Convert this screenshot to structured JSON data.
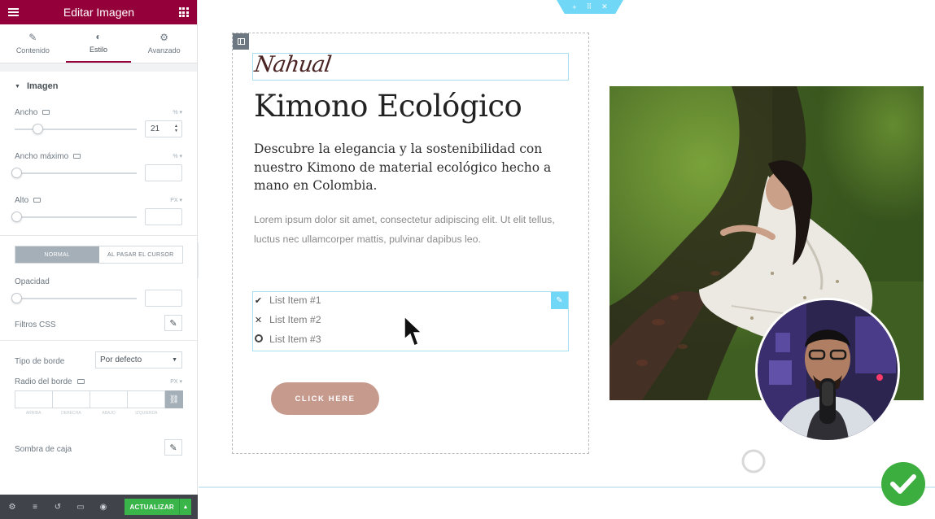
{
  "panel": {
    "title": "Editar Imagen",
    "tabs": [
      {
        "label": "Contenido",
        "icon": "pencil-icon"
      },
      {
        "label": "Estilo",
        "icon": "half-circle-icon",
        "active": true
      },
      {
        "label": "Avanzado",
        "icon": "gear-icon"
      }
    ],
    "section_title": "Imagen",
    "controls": {
      "width_label": "Ancho",
      "width_unit": "% ▾",
      "width_value": "21",
      "max_width_label": "Ancho máximo",
      "max_width_unit": "% ▾",
      "height_label": "Alto",
      "height_unit": "PX ▾",
      "state_normal": "NORMAL",
      "state_hover": "AL PASAR EL CURSOR",
      "opacity_label": "Opacidad",
      "css_filters_label": "Filtros CSS",
      "border_type_label": "Tipo de borde",
      "border_type_value": "Por defecto",
      "border_radius_label": "Radio del borde",
      "border_radius_unit": "PX ▾",
      "dim_labels": [
        "Arriba",
        "Derecha",
        "Abajo",
        "Izquierda"
      ],
      "box_shadow_label": "Sombra de caja"
    },
    "footer": {
      "update_label": "ACTUALIZAR"
    }
  },
  "canvas": {
    "section_tab_icons": [
      "plus-icon",
      "move-icon",
      "close-icon"
    ],
    "logo_text": "Nahual",
    "headline": "Kimono Ecológico",
    "subheadline": "Descubre la elegancia y la sostenibilidad con nuestro Kimono de material ecológico hecho a mano en Colombia.",
    "body": "Lorem ipsum dolor sit amet, consectetur adipiscing elit. Ut elit tellus, luctus nec ullamcorper mattis, pulvinar dapibus leo.",
    "list": [
      {
        "label": "List Item #1",
        "icon": "check-icon"
      },
      {
        "label": "List Item #2",
        "icon": "times-icon"
      },
      {
        "label": "List Item #3",
        "icon": "dot-circle-icon"
      }
    ],
    "cta_label": "CLICK HERE"
  },
  "colors": {
    "panel_header": "#93003a",
    "update_button": "#39b54a",
    "selection_blue": "#71d7f7",
    "cta": "#c79a8e"
  }
}
